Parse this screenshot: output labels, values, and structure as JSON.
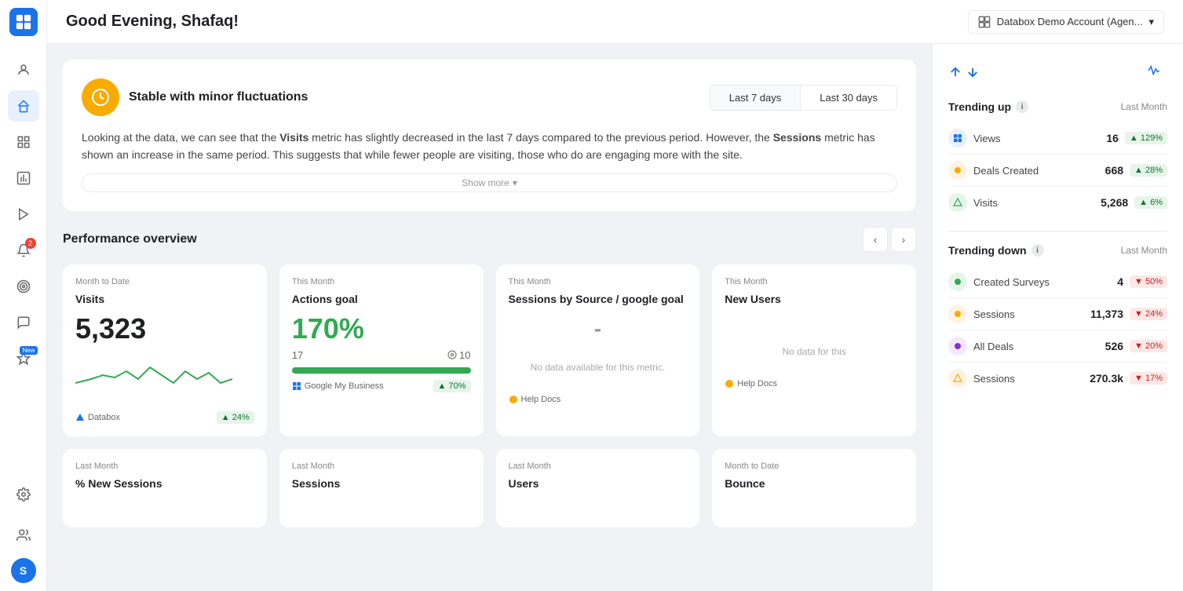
{
  "app": {
    "logo": "▣",
    "title": "Good Evening, Shafaq!"
  },
  "account_selector": {
    "icon": "▦",
    "label": "Databox Demo Account (Agen...",
    "chevron": "▾"
  },
  "sidebar": {
    "items": [
      {
        "id": "user-profile",
        "icon": "👤",
        "active": false,
        "badge": null
      },
      {
        "id": "home",
        "icon": "⊞",
        "active": true,
        "badge": null
      },
      {
        "id": "dashboard",
        "icon": "▣",
        "active": false,
        "badge": null
      },
      {
        "id": "metrics",
        "icon": "▤",
        "active": false,
        "badge": null
      },
      {
        "id": "media",
        "icon": "▶",
        "active": false,
        "badge": null
      },
      {
        "id": "alerts",
        "icon": "🔔",
        "active": false,
        "badge": "2"
      },
      {
        "id": "goals",
        "icon": "◎",
        "active": false,
        "badge": null
      },
      {
        "id": "messages",
        "icon": "💬",
        "active": false,
        "badge": null
      },
      {
        "id": "new-feature",
        "icon": "✦",
        "active": false,
        "new": true
      }
    ],
    "bottom_items": [
      {
        "id": "settings",
        "icon": "⚙"
      },
      {
        "id": "team",
        "icon": "👥"
      }
    ],
    "avatar": "S"
  },
  "insights": {
    "icon": "⏱",
    "title": "Stable with minor fluctuations",
    "tabs": [
      {
        "id": "last7",
        "label": "Last 7 days",
        "active": true
      },
      {
        "id": "last30",
        "label": "Last 30 days",
        "active": false
      }
    ],
    "text_parts": [
      "Looking at the data, we can see that the ",
      "Visits",
      " metric has slightly decreased in the last 7 days compared to the previous period. However, the ",
      "Sessions",
      " metric has shown an increase in the same period. This suggests that while fewer people are visiting, those who do are engaging more with the site."
    ],
    "expand_label": "Show more"
  },
  "performance": {
    "title": "Performance overview",
    "nav_prev": "‹",
    "nav_next": "›"
  },
  "cards_row1": [
    {
      "period": "Month to Date",
      "title": "Visits",
      "value": "5,323",
      "has_chart": true,
      "source_icon": "🔷",
      "source": "Databox",
      "badge": "▲ 24%",
      "badge_type": "up"
    },
    {
      "period": "This Month",
      "title": "Actions goal",
      "value": "170%",
      "value_color": "green",
      "goal_current": "17",
      "goal_target_icon": "🎯",
      "goal_target": "10",
      "progress": 100,
      "source_icon": "🔷",
      "source": "Google My Business",
      "badge": "▲ 70%",
      "badge_type": "up"
    },
    {
      "period": "This Month",
      "title": "Sessions by Source / google goal",
      "value": "-",
      "no_data": "No data available for this metric.",
      "source_icon": "🟠",
      "source": "Help Docs",
      "badge": null
    },
    {
      "period": "This Month",
      "title": "New Users",
      "value": "",
      "no_data": "No data for this",
      "source_icon": "🟠",
      "source": "Help Docs",
      "badge": null
    }
  ],
  "cards_row2": [
    {
      "period": "Last Month",
      "title": "% New Sessions",
      "value": ""
    },
    {
      "period": "Last Month",
      "title": "Sessions",
      "value": ""
    },
    {
      "period": "Last Month",
      "title": "Users",
      "value": ""
    },
    {
      "period": "Month to Date",
      "title": "Bounce",
      "value": ""
    }
  ],
  "right_panel": {
    "trending_up": {
      "label": "Trending up",
      "period": "Last Month",
      "items": [
        {
          "icon_type": "blue",
          "icon": "◈",
          "name": "Views",
          "value": "16",
          "badge": "▲ 129%",
          "badge_type": "up"
        },
        {
          "icon_type": "orange",
          "icon": "◉",
          "name": "Deals Created",
          "value": "668",
          "badge": "▲ 28%",
          "badge_type": "up"
        },
        {
          "icon_type": "teal",
          "icon": "◈",
          "name": "Visits",
          "value": "5,268",
          "badge": "▲ 6%",
          "badge_type": "up"
        }
      ]
    },
    "trending_down": {
      "label": "Trending down",
      "period": "Last Month",
      "items": [
        {
          "icon_type": "teal",
          "icon": "◉",
          "name": "Created Surveys",
          "value": "4",
          "badge": "▼ 50%",
          "badge_type": "down"
        },
        {
          "icon_type": "orange",
          "icon": "◉",
          "name": "Sessions",
          "value": "11,373",
          "badge": "▼ 24%",
          "badge_type": "down"
        },
        {
          "icon_type": "purple",
          "icon": "◉",
          "name": "All Deals",
          "value": "526",
          "badge": "▼ 20%",
          "badge_type": "down"
        },
        {
          "icon_type": "orange",
          "icon": "◈",
          "name": "Sessions",
          "value": "270.3k",
          "badge": "▼ 17%",
          "badge_type": "down"
        }
      ]
    }
  }
}
